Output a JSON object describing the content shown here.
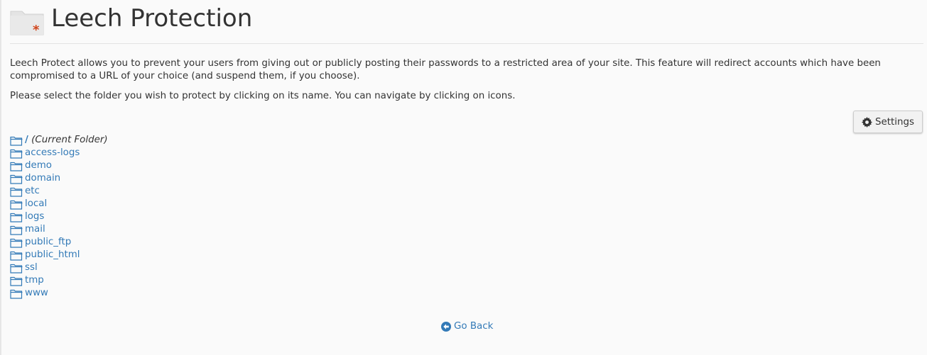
{
  "header": {
    "title": "Leech Protection"
  },
  "description": "Leech Protect allows you to prevent your users from giving out or publicly posting their passwords to a restricted area of your site. This feature will redirect accounts which have been compromised to a URL of your choice (and suspend them, if you choose).",
  "instructions": "Please select the folder you wish to protect by clicking on its name. You can navigate by clicking on icons.",
  "settings_button": {
    "label": "Settings"
  },
  "current_folder": {
    "name": "/",
    "label": "(Current Folder)"
  },
  "folders": [
    {
      "name": "access-logs"
    },
    {
      "name": "demo"
    },
    {
      "name": "domain"
    },
    {
      "name": "etc"
    },
    {
      "name": "local"
    },
    {
      "name": "logs"
    },
    {
      "name": "mail"
    },
    {
      "name": "public_ftp"
    },
    {
      "name": "public_html"
    },
    {
      "name": "ssl"
    },
    {
      "name": "tmp"
    },
    {
      "name": "www"
    }
  ],
  "go_back": {
    "label": "Go Back"
  },
  "colors": {
    "link": "#337ab7",
    "accent_asterisk": "#d0441b"
  }
}
